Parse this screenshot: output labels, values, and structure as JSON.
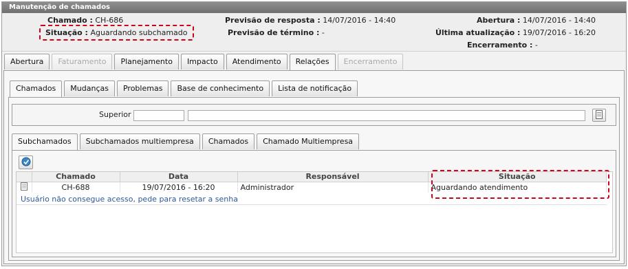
{
  "window": {
    "title": "Manutenção de chamados"
  },
  "header": {
    "chamado_label": "Chamado :",
    "chamado_value": "CH-686",
    "situacao_label": "Situação :",
    "situacao_value": "Aguardando subchamado",
    "previsao_resposta_label": "Previsão de resposta :",
    "previsao_resposta_value": "14/07/2016 - 14:40",
    "previsao_termino_label": "Previsão de término :",
    "previsao_termino_value": "-",
    "abertura_label": "Abertura :",
    "abertura_value": "14/07/2016 - 14:40",
    "ultima_atualizacao_label": "Última atualização :",
    "ultima_atualizacao_value": "19/07/2016 - 16:20",
    "encerramento_label": "Encerramento :",
    "encerramento_value": "-"
  },
  "main_tabs": [
    {
      "label": "Abertura",
      "state": "normal"
    },
    {
      "label": "Faturamento",
      "state": "disabled"
    },
    {
      "label": "Planejamento",
      "state": "normal"
    },
    {
      "label": "Impacto",
      "state": "normal"
    },
    {
      "label": "Atendimento",
      "state": "normal"
    },
    {
      "label": "Relações",
      "state": "active"
    },
    {
      "label": "Encerramento",
      "state": "disabled"
    }
  ],
  "relation_tabs": [
    {
      "label": "Chamados",
      "state": "active"
    },
    {
      "label": "Mudanças",
      "state": "normal"
    },
    {
      "label": "Problemas",
      "state": "normal"
    },
    {
      "label": "Base de conhecimento",
      "state": "normal"
    },
    {
      "label": "Lista de notificação",
      "state": "normal"
    }
  ],
  "superior": {
    "label": "Superior :",
    "code_value": "",
    "name_value": ""
  },
  "sub_tabs": [
    {
      "label": "Subchamados",
      "state": "active"
    },
    {
      "label": "Subchamados multiempresa",
      "state": "normal"
    },
    {
      "label": "Chamados",
      "state": "normal"
    },
    {
      "label": "Chamado Multiempresa",
      "state": "normal"
    }
  ],
  "grid": {
    "columns": [
      "",
      "Chamado",
      "Data",
      "Responsável",
      "Situação"
    ],
    "rows": [
      {
        "chamado": "CH-688",
        "data": "19/07/2016 - 16:20",
        "responsavel": "Administrador",
        "situacao": "Aguardando atendimento",
        "descricao": "Usuário não consegue acesso, pede para resetar a senha"
      }
    ]
  },
  "colors": {
    "annotation": "#d0021b",
    "link": "#2a5a9c",
    "titlebar": "#7a7a7a"
  },
  "icons": {
    "add": "add-subchamado-icon",
    "row": "document-icon",
    "lookup": "lookup-icon"
  }
}
